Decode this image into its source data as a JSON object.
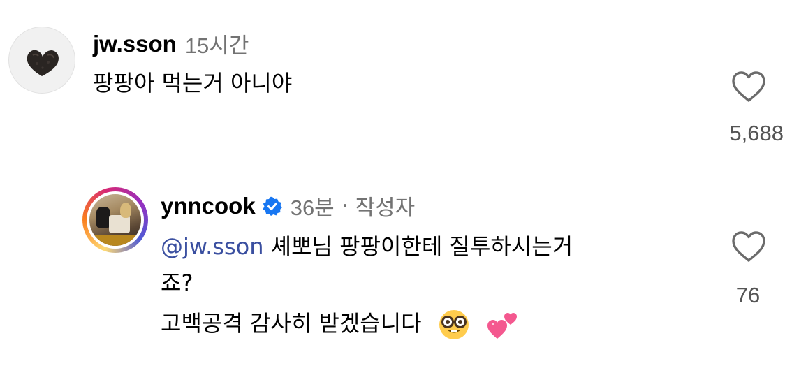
{
  "comments": [
    {
      "username": "jw.sson",
      "time": "15시간",
      "text": "팡팡아 먹는거 아니야",
      "like_count": "5,688",
      "avatar_icon": "chocolate-heart-avatar",
      "heart_icon": "heart-outline-icon"
    },
    {
      "username": "ynncook",
      "time": "36분",
      "separator": "·",
      "author_tag": "작성자",
      "mention": "@jw.sson",
      "text_line1": "셰뽀님 팡팡이한테 질투하시는거",
      "text_line2": "죠?",
      "text_line3": "고백공격 감사히 받겠습니다",
      "like_count": "76",
      "verified_icon": "verified-badge-icon",
      "emojis": [
        "nerd-face-emoji",
        "two-hearts-emoji"
      ],
      "heart_icon": "heart-outline-icon"
    }
  ],
  "colors": {
    "mention": "#3a4fa0",
    "verified": "#1877f2",
    "meta": "#737373"
  }
}
